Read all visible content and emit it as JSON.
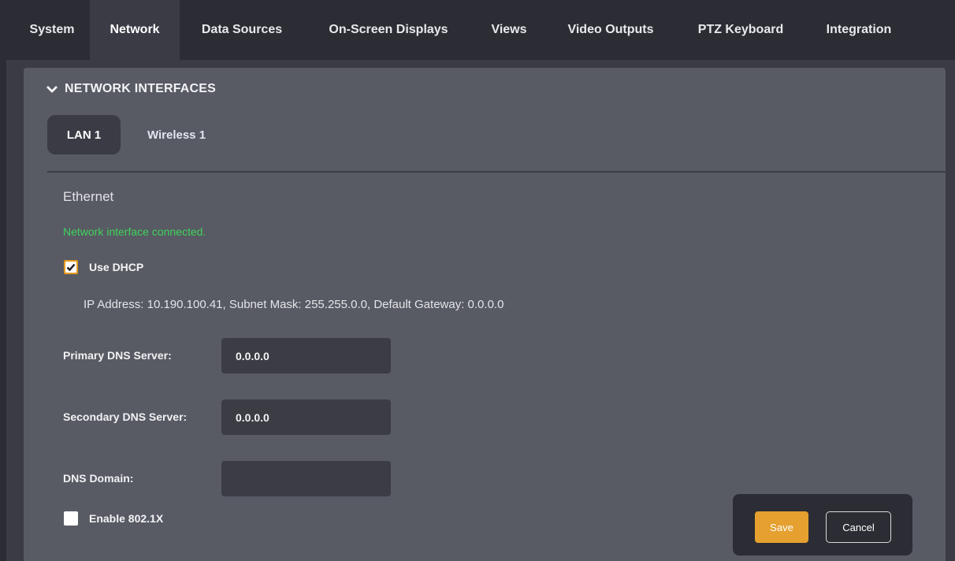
{
  "topnav": {
    "tabs": [
      {
        "label": "System"
      },
      {
        "label": "Network"
      },
      {
        "label": "Data Sources"
      },
      {
        "label": "On-Screen Displays"
      },
      {
        "label": "Views"
      },
      {
        "label": "Video Outputs"
      },
      {
        "label": "PTZ Keyboard"
      },
      {
        "label": "Integration"
      }
    ],
    "active": "Network"
  },
  "section": {
    "title": "NETWORK INTERFACES",
    "icon": "chevron-down-icon"
  },
  "interface_tabs": [
    {
      "label": "LAN 1",
      "active": true
    },
    {
      "label": "Wireless 1",
      "active": false
    }
  ],
  "interface": {
    "type": "Ethernet",
    "status": "Network interface connected.",
    "status_color": "#3fd35a",
    "use_dhcp": {
      "label": "Use DHCP",
      "checked": true
    },
    "ip_info": "IP Address: 10.190.100.41, Subnet Mask: 255.255.0.0, Default Gateway: 0.0.0.0",
    "primary_dns": {
      "label": "Primary DNS Server:",
      "value": "0.0.0.0"
    },
    "secondary_dns": {
      "label": "Secondary DNS Server:",
      "value": "0.0.0.0"
    },
    "dns_domain": {
      "label": "DNS Domain:",
      "value": ""
    },
    "enable_8021x": {
      "label": "Enable 802.1X",
      "checked": false
    }
  },
  "actions": {
    "save_label": "Save",
    "cancel_label": "Cancel"
  },
  "colors": {
    "accent": "#e5a02f",
    "background": "#3a3b44",
    "panel": "#585a64",
    "nav": "#2c2d34"
  }
}
